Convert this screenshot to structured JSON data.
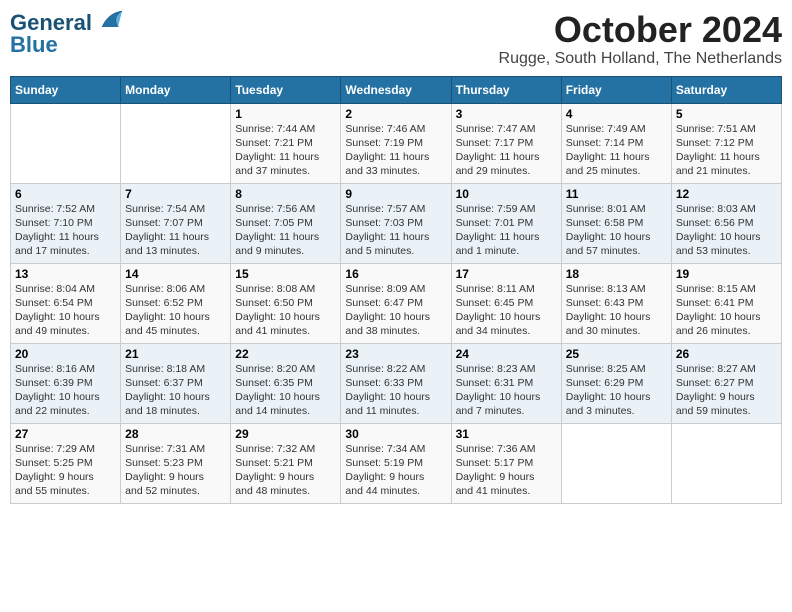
{
  "logo": {
    "line1": "General",
    "line2": "Blue"
  },
  "header": {
    "month": "October 2024",
    "location": "Rugge, South Holland, The Netherlands"
  },
  "weekdays": [
    "Sunday",
    "Monday",
    "Tuesday",
    "Wednesday",
    "Thursday",
    "Friday",
    "Saturday"
  ],
  "weeks": [
    [
      {
        "num": "",
        "detail": ""
      },
      {
        "num": "",
        "detail": ""
      },
      {
        "num": "1",
        "detail": "Sunrise: 7:44 AM\nSunset: 7:21 PM\nDaylight: 11 hours\nand 37 minutes."
      },
      {
        "num": "2",
        "detail": "Sunrise: 7:46 AM\nSunset: 7:19 PM\nDaylight: 11 hours\nand 33 minutes."
      },
      {
        "num": "3",
        "detail": "Sunrise: 7:47 AM\nSunset: 7:17 PM\nDaylight: 11 hours\nand 29 minutes."
      },
      {
        "num": "4",
        "detail": "Sunrise: 7:49 AM\nSunset: 7:14 PM\nDaylight: 11 hours\nand 25 minutes."
      },
      {
        "num": "5",
        "detail": "Sunrise: 7:51 AM\nSunset: 7:12 PM\nDaylight: 11 hours\nand 21 minutes."
      }
    ],
    [
      {
        "num": "6",
        "detail": "Sunrise: 7:52 AM\nSunset: 7:10 PM\nDaylight: 11 hours\nand 17 minutes."
      },
      {
        "num": "7",
        "detail": "Sunrise: 7:54 AM\nSunset: 7:07 PM\nDaylight: 11 hours\nand 13 minutes."
      },
      {
        "num": "8",
        "detail": "Sunrise: 7:56 AM\nSunset: 7:05 PM\nDaylight: 11 hours\nand 9 minutes."
      },
      {
        "num": "9",
        "detail": "Sunrise: 7:57 AM\nSunset: 7:03 PM\nDaylight: 11 hours\nand 5 minutes."
      },
      {
        "num": "10",
        "detail": "Sunrise: 7:59 AM\nSunset: 7:01 PM\nDaylight: 11 hours\nand 1 minute."
      },
      {
        "num": "11",
        "detail": "Sunrise: 8:01 AM\nSunset: 6:58 PM\nDaylight: 10 hours\nand 57 minutes."
      },
      {
        "num": "12",
        "detail": "Sunrise: 8:03 AM\nSunset: 6:56 PM\nDaylight: 10 hours\nand 53 minutes."
      }
    ],
    [
      {
        "num": "13",
        "detail": "Sunrise: 8:04 AM\nSunset: 6:54 PM\nDaylight: 10 hours\nand 49 minutes."
      },
      {
        "num": "14",
        "detail": "Sunrise: 8:06 AM\nSunset: 6:52 PM\nDaylight: 10 hours\nand 45 minutes."
      },
      {
        "num": "15",
        "detail": "Sunrise: 8:08 AM\nSunset: 6:50 PM\nDaylight: 10 hours\nand 41 minutes."
      },
      {
        "num": "16",
        "detail": "Sunrise: 8:09 AM\nSunset: 6:47 PM\nDaylight: 10 hours\nand 38 minutes."
      },
      {
        "num": "17",
        "detail": "Sunrise: 8:11 AM\nSunset: 6:45 PM\nDaylight: 10 hours\nand 34 minutes."
      },
      {
        "num": "18",
        "detail": "Sunrise: 8:13 AM\nSunset: 6:43 PM\nDaylight: 10 hours\nand 30 minutes."
      },
      {
        "num": "19",
        "detail": "Sunrise: 8:15 AM\nSunset: 6:41 PM\nDaylight: 10 hours\nand 26 minutes."
      }
    ],
    [
      {
        "num": "20",
        "detail": "Sunrise: 8:16 AM\nSunset: 6:39 PM\nDaylight: 10 hours\nand 22 minutes."
      },
      {
        "num": "21",
        "detail": "Sunrise: 8:18 AM\nSunset: 6:37 PM\nDaylight: 10 hours\nand 18 minutes."
      },
      {
        "num": "22",
        "detail": "Sunrise: 8:20 AM\nSunset: 6:35 PM\nDaylight: 10 hours\nand 14 minutes."
      },
      {
        "num": "23",
        "detail": "Sunrise: 8:22 AM\nSunset: 6:33 PM\nDaylight: 10 hours\nand 11 minutes."
      },
      {
        "num": "24",
        "detail": "Sunrise: 8:23 AM\nSunset: 6:31 PM\nDaylight: 10 hours\nand 7 minutes."
      },
      {
        "num": "25",
        "detail": "Sunrise: 8:25 AM\nSunset: 6:29 PM\nDaylight: 10 hours\nand 3 minutes."
      },
      {
        "num": "26",
        "detail": "Sunrise: 8:27 AM\nSunset: 6:27 PM\nDaylight: 9 hours\nand 59 minutes."
      }
    ],
    [
      {
        "num": "27",
        "detail": "Sunrise: 7:29 AM\nSunset: 5:25 PM\nDaylight: 9 hours\nand 55 minutes."
      },
      {
        "num": "28",
        "detail": "Sunrise: 7:31 AM\nSunset: 5:23 PM\nDaylight: 9 hours\nand 52 minutes."
      },
      {
        "num": "29",
        "detail": "Sunrise: 7:32 AM\nSunset: 5:21 PM\nDaylight: 9 hours\nand 48 minutes."
      },
      {
        "num": "30",
        "detail": "Sunrise: 7:34 AM\nSunset: 5:19 PM\nDaylight: 9 hours\nand 44 minutes."
      },
      {
        "num": "31",
        "detail": "Sunrise: 7:36 AM\nSunset: 5:17 PM\nDaylight: 9 hours\nand 41 minutes."
      },
      {
        "num": "",
        "detail": ""
      },
      {
        "num": "",
        "detail": ""
      }
    ]
  ]
}
